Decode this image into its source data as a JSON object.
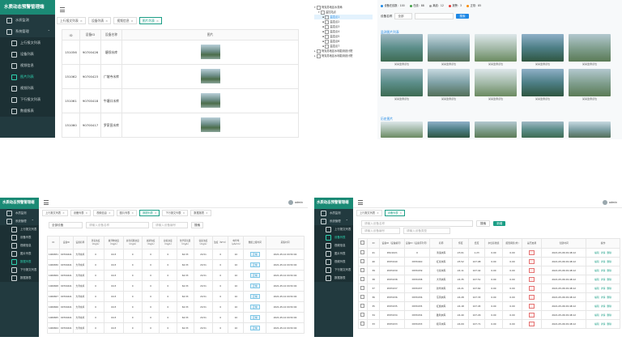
{
  "app_title": "水质动态预警管理端",
  "colors": {
    "sidebar": "#223a3f",
    "brand": "#1b8a75",
    "accent": "#1b9e86",
    "active_text": "#2ed3b0"
  },
  "p1": {
    "menu": [
      {
        "label": "水质监测",
        "icon": "home-icon",
        "sub": false
      },
      {
        "label": "系统管理",
        "icon": "settings-icon",
        "sub": false,
        "arrow": "⌃"
      },
      {
        "label": "上行报文列表",
        "icon": "doc-icon",
        "sub": true
      },
      {
        "label": "设备列表",
        "icon": "device-icon",
        "sub": true
      },
      {
        "label": "视频信息",
        "icon": "video-icon",
        "sub": true
      },
      {
        "label": "图片列表",
        "icon": "image-icon",
        "sub": true,
        "active": true
      },
      {
        "label": "视频列表",
        "icon": "video-icon",
        "sub": true
      },
      {
        "label": "下行报文列表",
        "icon": "doc-icon",
        "sub": true
      },
      {
        "label": "数据报表",
        "icon": "report-icon",
        "sub": true
      }
    ],
    "tabs": [
      "上行报文列表",
      "设备列表",
      "视频信息",
      "图片列表"
    ],
    "columns": [
      "ID",
      "设备ID",
      "设备名称",
      "图片"
    ],
    "rows": [
      {
        "id": "151056",
        "dev": "90700426",
        "name": "塘坝水库"
      },
      {
        "id": "151062",
        "dev": "90700423",
        "name": "广坡寺水库"
      },
      {
        "id": "151061",
        "dev": "90700418",
        "name": "牛塘口水库"
      },
      {
        "id": "151060",
        "dev": "90700417",
        "name": "罗家田水库"
      }
    ]
  },
  "p2": {
    "tree": [
      {
        "label": "阿克苏地区水务局",
        "level": 0,
        "exp": "▾"
      },
      {
        "label": "监控站点",
        "level": 1,
        "exp": "▾"
      },
      {
        "label": "监控点1",
        "level": 2,
        "sel": true
      },
      {
        "label": "监控点2",
        "level": 2
      },
      {
        "label": "监控点3",
        "level": 2
      },
      {
        "label": "监控点4",
        "level": 2
      },
      {
        "label": "监控点5",
        "level": 2
      },
      {
        "label": "监控点6",
        "level": 2
      },
      {
        "label": "监控点7",
        "level": 2
      },
      {
        "label": "阿克苏地区水利勘测设计院",
        "level": 0,
        "exp": "▸"
      },
      {
        "label": "阿克苏地区水利勘测设计院",
        "level": 0,
        "exp": "▸"
      }
    ],
    "legend": [
      {
        "label": "设备在线数",
        "value": "100",
        "color": "#1e88e5"
      },
      {
        "label": "在线",
        "value": "88",
        "color": "#43a047"
      },
      {
        "label": "离线",
        "value": "12",
        "color": "#9e9e9e"
      },
      {
        "label": "报警",
        "value": "3",
        "color": "#e53935"
      },
      {
        "label": "正常",
        "value": "85",
        "color": "#fb8c00"
      }
    ],
    "filter_label": "设备名称",
    "filter_value": "全部",
    "search_btn": "搜索",
    "section1": "监测图片列表",
    "section2": "历史图片",
    "captions": [
      "某某监测点位",
      "某某监测点位",
      "某某监测点位",
      "某某监测点位",
      "某某监测点位",
      "某某监测点位",
      "某某监测点位",
      "某某监测点位",
      "某某监测点位",
      "某某监测点位"
    ]
  },
  "p3": {
    "menu": [
      {
        "label": "水质监测",
        "sub": false
      },
      {
        "label": "系统管理",
        "sub": false,
        "arrow": "⌃"
      },
      {
        "label": "上行报文列表",
        "sub": true
      },
      {
        "label": "设备列表",
        "sub": true
      },
      {
        "label": "视频信息",
        "sub": true
      },
      {
        "label": "图片列表",
        "sub": true
      },
      {
        "label": "数据列表",
        "sub": true,
        "active": true
      },
      {
        "label": "下行报文列表",
        "sub": true
      },
      {
        "label": "数据报表",
        "sub": true
      }
    ],
    "user": "admin",
    "tabs": [
      "上行报文列表",
      "设备列表",
      "视频信息",
      "图片列表",
      "数据列表",
      "下行报文列表",
      "数据报表"
    ],
    "active_tab": 4,
    "filter1": "全部设备",
    "filter2": "请输入设备名称",
    "filter3": "请输入设备编号",
    "search_btn": "搜索",
    "columns": [
      "ID",
      "设备ID",
      "设备名称",
      "消毒浓度（mg/L）",
      "悬浮物浓度（mg/L）",
      "总有机碳浓度（mg/L）",
      "总磷浓度（mg/L）",
      "总氮浓度（mg/L）",
      "化学需氧量（mg/L）",
      "氨氮浓度（mg/L）",
      "浊度（NTU）",
      "电导率（μS/cm）",
      "数据上报时间",
      "采集时间"
    ],
    "rows": [
      {
        "id": "1006831",
        "dev": "90700441",
        "name": "大湾水库"
      },
      {
        "id": "1006830",
        "dev": "90700441",
        "name": "大湾水库"
      },
      {
        "id": "1006829",
        "dev": "90700441",
        "name": "大湾水库"
      },
      {
        "id": "1006828",
        "dev": "90700441",
        "name": "大湾水库"
      },
      {
        "id": "1006827",
        "dev": "90700441",
        "name": "大湾水库"
      },
      {
        "id": "1006826",
        "dev": "90700441",
        "name": "大湾水库"
      },
      {
        "id": "1006825",
        "dev": "90700441",
        "name": "大湾水库"
      },
      {
        "id": "1006824",
        "dev": "90700441",
        "name": "大湾水库"
      }
    ],
    "vals": [
      "0",
      "64.5",
      "0",
      "0",
      "0",
      "64.33",
      "24.51",
      "0",
      "10"
    ],
    "status": "正常",
    "date": "2021-05-10 09:52:00"
  },
  "p4": {
    "menu": [
      {
        "label": "水质监测",
        "sub": false
      },
      {
        "label": "系统管理",
        "sub": false,
        "arrow": "⌃"
      },
      {
        "label": "上行报文列表",
        "sub": true
      },
      {
        "label": "设备列表",
        "sub": true,
        "active": true
      },
      {
        "label": "视频信息",
        "sub": true
      },
      {
        "label": "图片列表",
        "sub": true
      },
      {
        "label": "视频列表",
        "sub": true
      },
      {
        "label": "下行报文列表",
        "sub": true
      },
      {
        "label": "数据报表",
        "sub": true
      }
    ],
    "user": "admin",
    "tabs": [
      "上行报文列表",
      "设备列表"
    ],
    "filter1": "请输入设备名称",
    "filter2": "请输入设备编号",
    "filter3": "请输入设备类型",
    "search_btn": "搜索",
    "add_btn": "新增",
    "columns": [
      "",
      "ID",
      "设备ID（设备编号）",
      "设备ID（设备序列号）",
      "名称",
      "纬度",
      "经度",
      "水位基准值",
      "报警阈值(米)",
      "是否启用",
      "创建时间",
      "操作"
    ],
    "rows": [
      {
        "id": "41",
        "a": "DSC1021",
        "b": "0",
        "name": "清溪水库",
        "lat": "23.01",
        "lng": "1.23",
        "base": "0.00"
      },
      {
        "id": "40",
        "a": "DSTC040",
        "b": "DSTC040",
        "name": "红星水库",
        "lat": "25.52",
        "lng": "107.08",
        "base": "0.00"
      },
      {
        "id": "39",
        "a": "DSTC039",
        "b": "DSTC039",
        "name": "七星水库",
        "lat": "24.11",
        "lng": "107.42",
        "base": "0.00"
      },
      {
        "id": "38",
        "a": "DSTC038",
        "b": "DSTC038",
        "name": "大湾水库",
        "lat": "24.35",
        "lng": "107.51",
        "base": "0.00"
      },
      {
        "id": "37",
        "a": "DSTC037",
        "b": "DSTC037",
        "name": "新华水库",
        "lat": "24.21",
        "lng": "107.62",
        "base": "0.00"
      },
      {
        "id": "36",
        "a": "DSTC036",
        "b": "DSTC036",
        "name": "东风水库",
        "lat": "24.28",
        "lng": "107.33",
        "base": "0.00"
      },
      {
        "id": "35",
        "a": "DSTC035",
        "b": "DSTC035",
        "name": "红旗水库",
        "lat": "24.18",
        "lng": "107.45",
        "base": "0.00"
      },
      {
        "id": "34",
        "a": "DSTC034",
        "b": "DSTC034",
        "name": "胜利水库",
        "lat": "24.40",
        "lng": "107.29",
        "base": "0.00"
      },
      {
        "id": "33",
        "a": "DSTC033",
        "b": "DSTC033",
        "name": "和平水库",
        "lat": "24.09",
        "lng": "107.71",
        "base": "0.00"
      }
    ],
    "threshold": "0.00",
    "date": "2021-05-06 09:48:12",
    "actions": [
      "编辑",
      "详情",
      "删除"
    ]
  }
}
